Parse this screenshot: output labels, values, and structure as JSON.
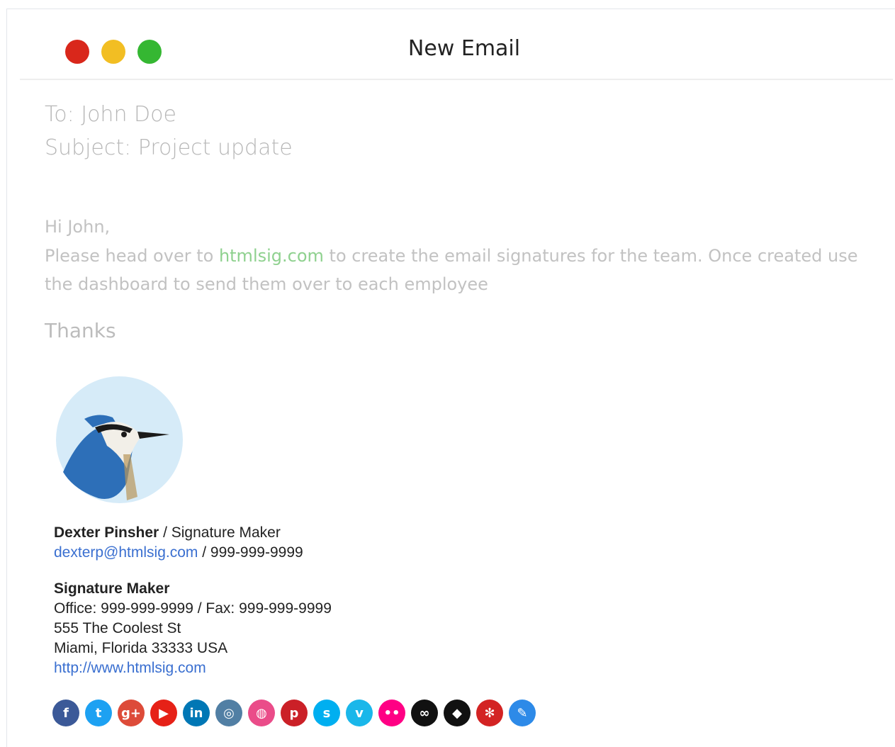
{
  "window": {
    "title": "New Email"
  },
  "email": {
    "to_label": "To: John Doe",
    "subject_label": "Subject: Project update",
    "greeting": "Hi John,",
    "body_before_link": "Please head over to ",
    "body_link": "htmlsig.com",
    "body_after_link": " to create the email signatures for the team. Once created use the dashboard to send them over to each employee",
    "closing": "Thanks"
  },
  "signature": {
    "name": "Dexter Pinsher",
    "separator": " / ",
    "role": "Signature Maker",
    "email": "dexterp@htmlsig.com",
    "phone_sep": " / ",
    "phone": "999-999-9999",
    "company": "Signature Maker",
    "office_line": "Office: 999-999-9999 / Fax: 999-999-9999",
    "street": "555 The Coolest St",
    "city_line": "Miami, Florida 33333 USA",
    "website": "http://www.htmlsig.com"
  },
  "social_icons": [
    {
      "name": "facebook-icon",
      "glyph": "f",
      "color": "#3b5998"
    },
    {
      "name": "twitter-icon",
      "glyph": "t",
      "color": "#1da1f2"
    },
    {
      "name": "google-plus-icon",
      "glyph": "g+",
      "color": "#dd4b39"
    },
    {
      "name": "youtube-icon",
      "glyph": "▶",
      "color": "#e62117"
    },
    {
      "name": "linkedin-icon",
      "glyph": "in",
      "color": "#0077b5"
    },
    {
      "name": "instagram-icon",
      "glyph": "◎",
      "color": "#517fa4"
    },
    {
      "name": "dribbble-icon",
      "glyph": "◍",
      "color": "#ea4c89"
    },
    {
      "name": "pinterest-icon",
      "glyph": "p",
      "color": "#cb2027"
    },
    {
      "name": "skype-icon",
      "glyph": "s",
      "color": "#00aff0"
    },
    {
      "name": "vimeo-icon",
      "glyph": "v",
      "color": "#1ab7ea"
    },
    {
      "name": "flickr-icon",
      "glyph": "••",
      "color": "#ff0084"
    },
    {
      "name": "infinity-icon",
      "glyph": "∞",
      "color": "#111111"
    },
    {
      "name": "github-icon",
      "glyph": "◆",
      "color": "#111111"
    },
    {
      "name": "yelp-icon",
      "glyph": "✻",
      "color": "#d32323"
    },
    {
      "name": "delicious-icon",
      "glyph": "✎",
      "color": "#2d8ae8"
    }
  ]
}
